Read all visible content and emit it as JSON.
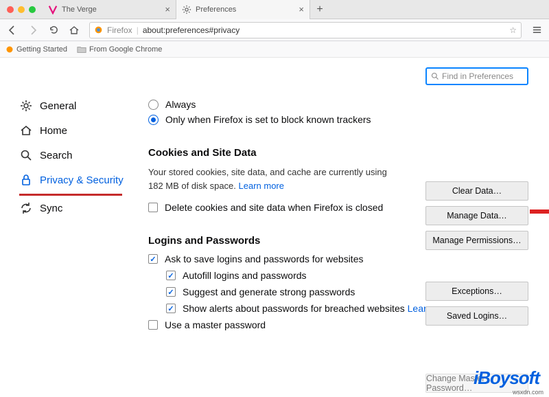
{
  "tabs": [
    {
      "title": "The Verge"
    },
    {
      "title": "Preferences"
    }
  ],
  "url": "about:preferences#privacy",
  "url_prefix": "Firefox",
  "bookmarks": [
    "Getting Started",
    "From Google Chrome"
  ],
  "sidebar": {
    "items": [
      {
        "label": "General"
      },
      {
        "label": "Home"
      },
      {
        "label": "Search"
      },
      {
        "label": "Privacy & Security"
      },
      {
        "label": "Sync"
      }
    ]
  },
  "search": {
    "placeholder": "Find in Preferences"
  },
  "radios": {
    "always": "Always",
    "only_trackers": "Only when Firefox is set to block known trackers"
  },
  "cookies": {
    "heading": "Cookies and Site Data",
    "desc_a": "Your stored cookies, site data, and cache are currently using 182 MB of disk space. ",
    "learn_more": "Learn more",
    "delete_on_close": "Delete cookies and site data when Firefox is closed",
    "buttons": {
      "clear": "Clear Data…",
      "manage": "Manage Data…",
      "perms": "Manage Permissions…"
    }
  },
  "logins": {
    "heading": "Logins and Passwords",
    "ask": "Ask to save logins and passwords for websites",
    "autofill": "Autofill logins and passwords",
    "suggest": "Suggest and generate strong passwords",
    "alerts_a": "Show alerts about passwords for breached websites ",
    "learn_more": "Learn more",
    "master": "Use a master password",
    "buttons": {
      "exc": "Exceptions…",
      "saved": "Saved Logins…",
      "change": "Change Master Password…"
    }
  },
  "logo": "iBoysoft",
  "watermark": "wsxdn.com"
}
